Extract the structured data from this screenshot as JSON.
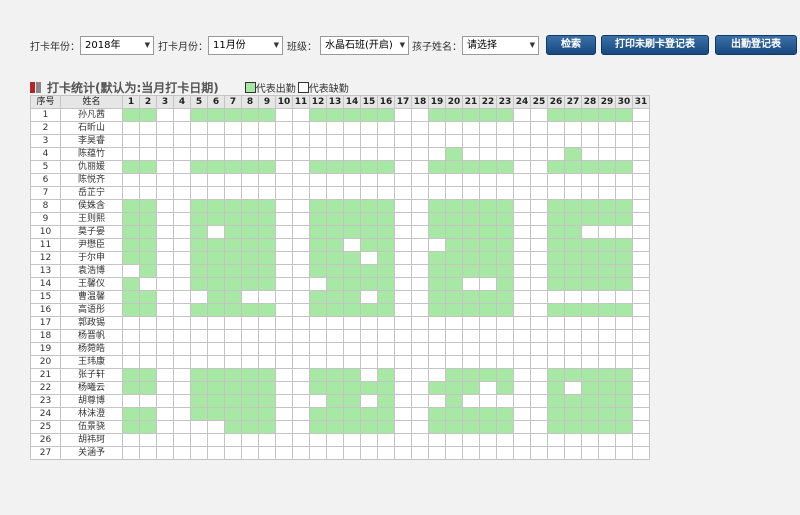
{
  "colors": {
    "present": "#a7e8a5",
    "absent": "#ffffff",
    "button": "#1f5590",
    "accent_red": "#c0392b"
  },
  "filters": {
    "year_label": "打卡年份：",
    "year_value": "2018年",
    "month_label": "打卡月份：",
    "month_value": "11月份",
    "class_label": "班级：",
    "class_value": "水晶石班(开启)",
    "child_label": "孩子姓名：",
    "child_value": "请选择",
    "dropdown_icon": "triangle-down-icon"
  },
  "buttons": {
    "search": "检索",
    "print_unpunched": "打印未刷卡登记表",
    "attendance_form": "出勤登记表"
  },
  "section": {
    "title": "打卡统计(默认为:当月打卡日期)",
    "legend_present": "代表出勤",
    "legend_absent": "代表缺勤"
  },
  "table": {
    "header_no": "序号",
    "header_name": "姓名",
    "days": [
      "1",
      "2",
      "3",
      "4",
      "5",
      "6",
      "7",
      "8",
      "9",
      "10",
      "11",
      "12",
      "13",
      "14",
      "15",
      "16",
      "17",
      "18",
      "19",
      "20",
      "21",
      "22",
      "23",
      "24",
      "25",
      "26",
      "27",
      "28",
      "29",
      "30",
      "31"
    ],
    "rows": [
      {
        "no": "1",
        "name": "孙凡茜",
        "present": [
          1,
          2,
          5,
          6,
          7,
          8,
          9,
          12,
          13,
          14,
          15,
          16,
          19,
          20,
          21,
          22,
          23,
          26,
          27,
          28,
          29,
          30
        ]
      },
      {
        "no": "2",
        "name": "石昕山",
        "present": []
      },
      {
        "no": "3",
        "name": "李昊睿",
        "present": []
      },
      {
        "no": "4",
        "name": "陈蕴竹",
        "present": [
          20,
          27
        ]
      },
      {
        "no": "5",
        "name": "仇丽媛",
        "present": [
          1,
          2,
          5,
          6,
          7,
          8,
          9,
          12,
          13,
          14,
          15,
          16,
          19,
          20,
          21,
          22,
          23,
          26,
          27,
          28,
          29,
          30
        ]
      },
      {
        "no": "6",
        "name": "陈悦齐",
        "present": []
      },
      {
        "no": "7",
        "name": "岳芷宁",
        "present": []
      },
      {
        "no": "8",
        "name": "侯姝含",
        "present": [
          1,
          2,
          5,
          6,
          7,
          8,
          9,
          12,
          13,
          14,
          15,
          16,
          19,
          20,
          21,
          22,
          23,
          26,
          27,
          28,
          29,
          30
        ]
      },
      {
        "no": "9",
        "name": "王则熙",
        "present": [
          1,
          2,
          5,
          6,
          7,
          8,
          9,
          12,
          13,
          14,
          15,
          16,
          19,
          20,
          21,
          22,
          23,
          26,
          27,
          28,
          29,
          30
        ]
      },
      {
        "no": "10",
        "name": "莫子晏",
        "present": [
          1,
          2,
          5,
          7,
          8,
          9,
          12,
          13,
          14,
          15,
          16,
          19,
          20,
          21,
          22,
          23,
          26,
          27
        ]
      },
      {
        "no": "11",
        "name": "尹懋臣",
        "present": [
          1,
          2,
          5,
          6,
          7,
          8,
          9,
          12,
          13,
          15,
          16,
          20,
          21,
          22,
          23,
          26,
          27,
          28,
          29,
          30
        ]
      },
      {
        "no": "12",
        "name": "于尔申",
        "present": [
          1,
          2,
          5,
          6,
          7,
          8,
          9,
          12,
          13,
          14,
          16,
          19,
          20,
          21,
          22,
          23,
          26,
          27,
          28,
          29,
          30
        ]
      },
      {
        "no": "13",
        "name": "袁浩博",
        "present": [
          2,
          5,
          6,
          7,
          8,
          9,
          12,
          13,
          14,
          15,
          16,
          19,
          20,
          21,
          22,
          23,
          26,
          27,
          28,
          29,
          30
        ]
      },
      {
        "no": "14",
        "name": "王馨仪",
        "present": [
          1,
          5,
          6,
          7,
          8,
          9,
          13,
          14,
          15,
          16,
          19,
          20,
          23,
          26,
          27,
          28,
          29,
          30
        ]
      },
      {
        "no": "15",
        "name": "曹温馨",
        "present": [
          1,
          2,
          6,
          7,
          12,
          13,
          14,
          16,
          19,
          20,
          21,
          22,
          23
        ]
      },
      {
        "no": "16",
        "name": "高语彤",
        "present": [
          1,
          2,
          5,
          6,
          7,
          8,
          9,
          12,
          13,
          14,
          15,
          16,
          19,
          20,
          21,
          22,
          23,
          26,
          27,
          28,
          29,
          30
        ]
      },
      {
        "no": "17",
        "name": "郭政锡",
        "present": []
      },
      {
        "no": "18",
        "name": "杨晋帆",
        "present": []
      },
      {
        "no": "19",
        "name": "杨菀皓",
        "present": []
      },
      {
        "no": "20",
        "name": "王玮康",
        "present": []
      },
      {
        "no": "21",
        "name": "张子轩",
        "present": [
          1,
          2,
          5,
          6,
          7,
          8,
          9,
          12,
          13,
          14,
          16,
          20,
          21,
          22,
          23,
          26,
          27,
          28,
          29,
          30
        ]
      },
      {
        "no": "22",
        "name": "杨曦云",
        "present": [
          1,
          2,
          5,
          6,
          7,
          8,
          9,
          12,
          13,
          14,
          15,
          16,
          19,
          20,
          21,
          23,
          26,
          28,
          29,
          30
        ]
      },
      {
        "no": "23",
        "name": "胡尊博",
        "present": [
          5,
          6,
          7,
          8,
          9,
          13,
          14,
          16,
          20,
          26,
          27,
          28,
          29,
          30
        ]
      },
      {
        "no": "24",
        "name": "林沫澄",
        "present": [
          1,
          2,
          5,
          6,
          7,
          8,
          9,
          12,
          13,
          14,
          15,
          16,
          19,
          20,
          21,
          22,
          23,
          26,
          27,
          28,
          29,
          30
        ]
      },
      {
        "no": "25",
        "name": "伍景骁",
        "present": [
          1,
          2,
          7,
          8,
          9,
          12,
          13,
          14,
          15,
          16,
          19,
          20,
          21,
          22,
          23,
          26,
          27,
          28,
          29,
          30
        ]
      },
      {
        "no": "26",
        "name": "胡祎珂",
        "present": []
      },
      {
        "no": "27",
        "name": "关涵予",
        "present": []
      }
    ]
  }
}
